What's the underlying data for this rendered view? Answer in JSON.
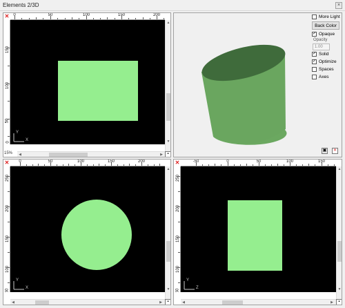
{
  "window": {
    "title": "Elements 2/3D",
    "close_glyph": "×"
  },
  "panes": {
    "top_left": {
      "ruler_h": [
        "0",
        "50",
        "100",
        "150",
        "200"
      ],
      "ruler_v": [
        "150",
        "100",
        "50",
        "0"
      ],
      "corner_label": "x",
      "axes": {
        "y": "Y",
        "x": "X"
      },
      "bottom_left_label": "15%",
      "shape": "rectangle",
      "shape_color": "#95ee8f"
    },
    "top_right_3d": {
      "cylinder_top_color": "#3f6b3b",
      "cylinder_side_color": "#6ba860",
      "options": {
        "more_light": {
          "label": "More Light",
          "checked": false
        },
        "back_color_button": "Back Color",
        "opaque": {
          "label": "Opaque",
          "checked": true
        },
        "opacity_label": "Opacity",
        "opacity_value": "1.00",
        "solid": {
          "label": "Solid",
          "checked": true
        },
        "optimize": {
          "label": "Optimize",
          "checked": true
        },
        "spaces": {
          "label": "Spaces",
          "checked": false
        },
        "axes": {
          "label": "Axes",
          "checked": false
        }
      }
    },
    "bottom_left": {
      "ruler_h": [
        "0",
        "50",
        "100",
        "150",
        "200"
      ],
      "ruler_v": [
        "250",
        "200",
        "150",
        "100",
        "50"
      ],
      "axes": {
        "y": "Y",
        "x": "X"
      },
      "shape": "circle",
      "shape_color": "#95ee8f"
    },
    "bottom_right": {
      "ruler_h": [
        "-50",
        "0",
        "50",
        "100",
        "150"
      ],
      "ruler_v": [
        "250",
        "200",
        "150",
        "100",
        "50"
      ],
      "axes": {
        "y": "Y",
        "x": "Z"
      },
      "shape": "rectangle",
      "shape_color": "#95ee8f"
    }
  }
}
